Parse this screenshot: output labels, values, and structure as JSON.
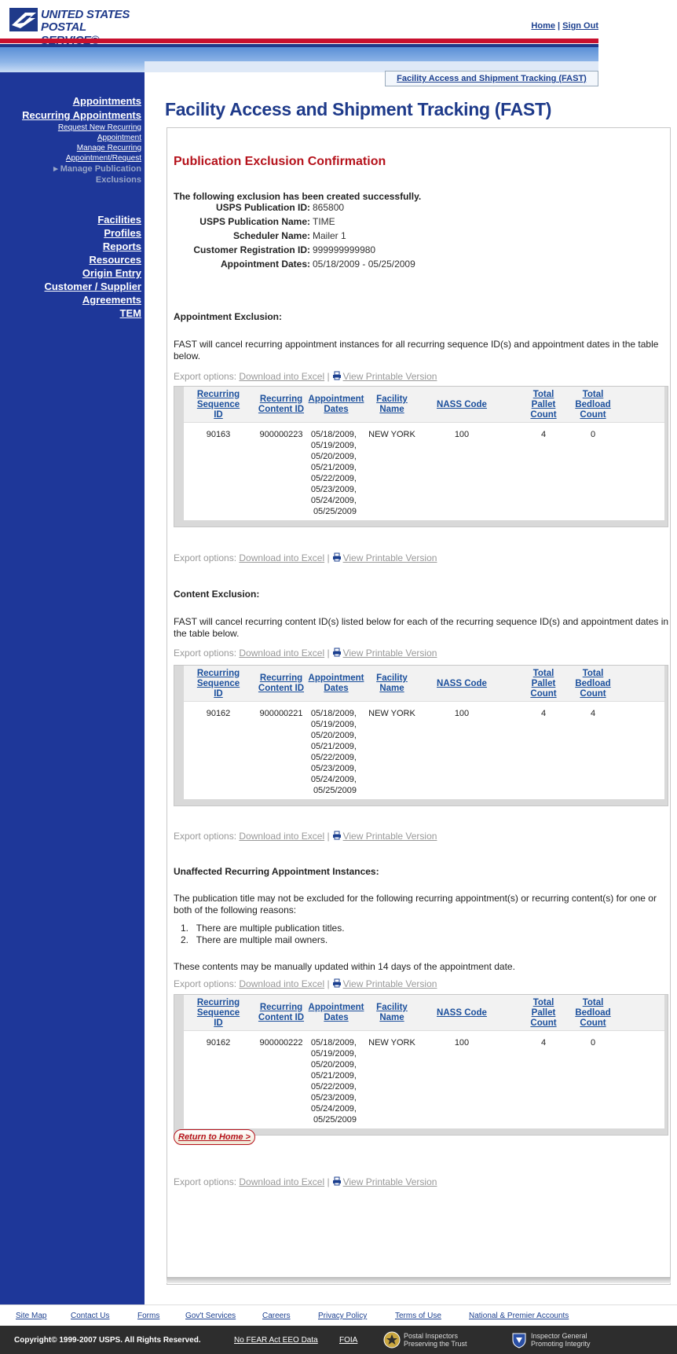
{
  "brand": {
    "line1": "UNITED STATES",
    "line2": "POSTAL SERVICE®"
  },
  "header": {
    "home_link": "Home",
    "separator": "|",
    "signout_link": "Sign Out"
  },
  "sidebar": {
    "group1": [
      {
        "label": "Appointments",
        "style": "main"
      },
      {
        "label": "Recurring Appointments",
        "style": "main"
      },
      {
        "label": "Request New Recurring",
        "style": "sub"
      },
      {
        "label": "Appointment",
        "style": "sub"
      },
      {
        "label": "Manage Recurring",
        "style": "sub"
      },
      {
        "label": "Appointment/Request",
        "style": "sub"
      },
      {
        "label": "Manage Publication",
        "style": "current"
      },
      {
        "label": "Exclusions",
        "style": "current"
      }
    ],
    "group2": [
      "Facilities",
      "Profiles",
      "Reports",
      "Resources",
      "Origin Entry",
      "Customer / Supplier",
      "Agreements",
      "TEM"
    ]
  },
  "app_tab": "Facility Access and Shipment Tracking (FAST)",
  "page_title": "Facility Access and Shipment Tracking (FAST)",
  "confirmation": {
    "title": "Publication Exclusion Confirmation",
    "message": "The following exclusion has been created successfully.",
    "fields": [
      {
        "label": "USPS Publication ID:",
        "value": "865800"
      },
      {
        "label": "USPS Publication Name:",
        "value": "TIME"
      },
      {
        "label": "Scheduler Name:",
        "value": "Mailer 1"
      },
      {
        "label": "Customer Registration ID:",
        "value": "999999999980"
      },
      {
        "label": "Appointment Dates:",
        "value": "05/18/2009 - 05/25/2009"
      }
    ]
  },
  "export": {
    "prefix": "Export options:",
    "excel": "Download into Excel",
    "sep": "|",
    "printable": "View Printable Version"
  },
  "columns": [
    {
      "lines": [
        "Recurring",
        "Sequence",
        "ID"
      ]
    },
    {
      "lines": [
        "Recurring",
        "Content ID"
      ]
    },
    {
      "lines": [
        "Appointment",
        "Dates"
      ]
    },
    {
      "lines": [
        "Facility Name"
      ]
    },
    {
      "lines": [
        "NASS Code"
      ]
    },
    {
      "lines": [
        "Total Pallet",
        "Count"
      ]
    },
    {
      "lines": [
        "Total",
        "Bedload",
        "Count"
      ]
    }
  ],
  "sections": [
    {
      "heading": "Appointment Exclusion:",
      "description": "FAST will cancel recurring appointment instances for all recurring sequence ID(s) and appointment dates in the table below.",
      "row": {
        "seq": "90163",
        "content": "900000223",
        "dates": [
          "05/18/2009,",
          "05/19/2009,",
          "05/20/2009,",
          "05/21/2009,",
          "05/22/2009,",
          "05/23/2009,",
          "05/24/2009,",
          "05/25/2009"
        ],
        "facility": "NEW YORK",
        "nass": "100",
        "pallet": "4",
        "bedload": "0"
      }
    },
    {
      "heading": "Content Exclusion:",
      "description": "FAST will cancel recurring content ID(s) listed below for each of the recurring sequence ID(s) and appointment dates in the table below.",
      "row": {
        "seq": "90162",
        "content": "900000221",
        "dates": [
          "05/18/2009,",
          "05/19/2009,",
          "05/20/2009,",
          "05/21/2009,",
          "05/22/2009,",
          "05/23/2009,",
          "05/24/2009,",
          "05/25/2009"
        ],
        "facility": "NEW YORK",
        "nass": "100",
        "pallet": "4",
        "bedload": "4"
      }
    },
    {
      "heading": "Unaffected Recurring Appointment Instances:",
      "description": "The publication title may not be excluded for the following recurring appointment(s) or recurring content(s) for one or both of the following reasons:",
      "reasons": [
        "There are multiple publication titles.",
        "There are multiple mail owners."
      ],
      "note": "These contents may be manually updated within 14 days of the appointment date.",
      "row": {
        "seq": "90162",
        "content": "900000222",
        "dates": [
          "05/18/2009,",
          "05/19/2009,",
          "05/20/2009,",
          "05/21/2009,",
          "05/22/2009,",
          "05/23/2009,",
          "05/24/2009,",
          "05/25/2009"
        ],
        "facility": "NEW YORK",
        "nass": "100",
        "pallet": "4",
        "bedload": "0"
      }
    }
  ],
  "return_button": "Return to Home >",
  "footer": {
    "links": [
      "Site Map",
      "Contact Us",
      "Forms",
      "Gov't Services",
      "Careers",
      "Privacy Policy",
      "Terms of Use",
      "National & Premier Accounts"
    ],
    "copyright": "Copyright© 1999-2007 USPS. All Rights Reserved.",
    "legal_links": [
      "No FEAR Act EEO Data",
      "FOIA"
    ],
    "seal1": [
      "Postal Inspectors",
      "Preserving the Trust"
    ],
    "seal2": [
      "Inspector General",
      "Promoting Integrity"
    ]
  }
}
